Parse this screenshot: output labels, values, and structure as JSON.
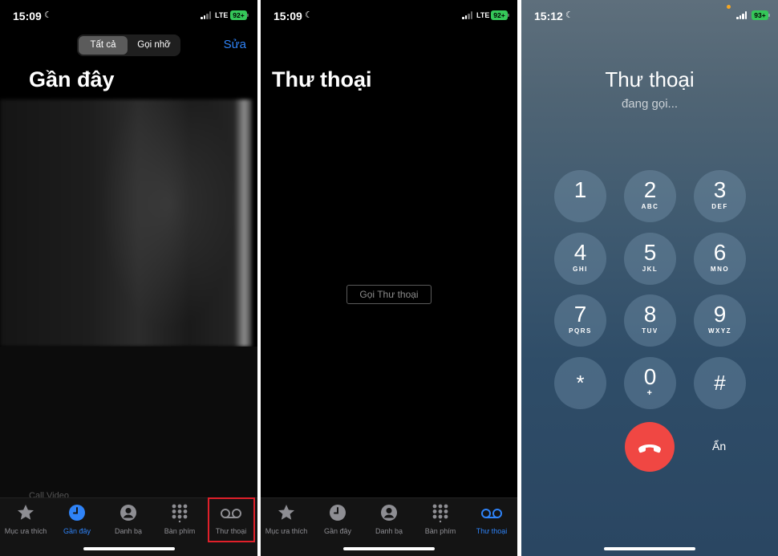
{
  "panel1": {
    "status": {
      "time": "15:09",
      "network": "LTE",
      "battery": "92+"
    },
    "segment": {
      "all": "Tất cả",
      "missed": "Gọi nhỡ"
    },
    "edit_label": "Sửa",
    "title": "Gần đây",
    "faint_text": "Call Video"
  },
  "panel2": {
    "status": {
      "time": "15:09",
      "network": "LTE",
      "battery": "92+"
    },
    "title": "Thư thoại",
    "call_voicemail_button": "Gọi Thư thoại"
  },
  "tabs": {
    "favorites": "Mục ưa thích",
    "recents": "Gần đây",
    "contacts": "Danh bạ",
    "keypad": "Bàn phím",
    "voicemail": "Thư thoại"
  },
  "panel3": {
    "status": {
      "time": "15:12",
      "battery": "93+"
    },
    "call_name": "Thư thoại",
    "call_status": "đang gọi...",
    "keys": [
      {
        "digit": "1",
        "letters": ""
      },
      {
        "digit": "2",
        "letters": "ABC"
      },
      {
        "digit": "3",
        "letters": "DEF"
      },
      {
        "digit": "4",
        "letters": "GHI"
      },
      {
        "digit": "5",
        "letters": "JKL"
      },
      {
        "digit": "6",
        "letters": "MNO"
      },
      {
        "digit": "7",
        "letters": "PQRS"
      },
      {
        "digit": "8",
        "letters": "TUV"
      },
      {
        "digit": "9",
        "letters": "WXYZ"
      },
      {
        "digit": "*",
        "letters": ""
      },
      {
        "digit": "0",
        "letters": "+"
      },
      {
        "digit": "#",
        "letters": ""
      }
    ],
    "hide_label": "Ẩn"
  },
  "colors": {
    "accent": "#2f83f7",
    "end_call": "#f04743",
    "highlight": "#e0202a",
    "battery": "#35c759"
  }
}
